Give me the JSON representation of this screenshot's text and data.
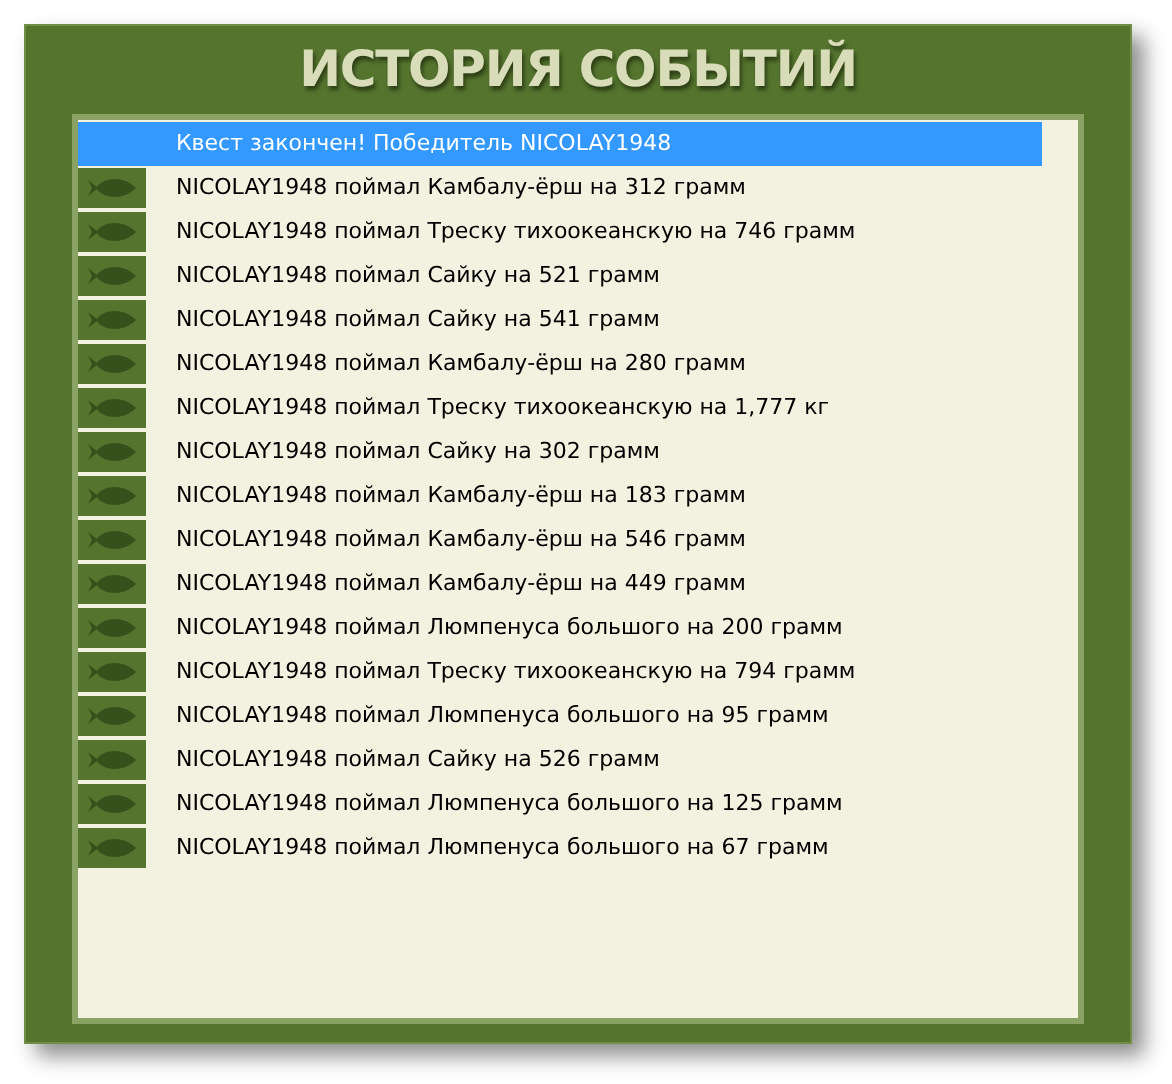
{
  "title": "ИСТОРИЯ СОБЫТИЙ",
  "events": [
    {
      "kind": "message",
      "selected": true,
      "text": "Квест закончен! Победитель NICOLAY1948"
    },
    {
      "kind": "catch",
      "selected": false,
      "text": "NICOLAY1948 поймал Камбалу-ёрш на 312 грамм"
    },
    {
      "kind": "catch",
      "selected": false,
      "text": "NICOLAY1948 поймал Треску тихоокеанскую на 746 грамм"
    },
    {
      "kind": "catch",
      "selected": false,
      "text": "NICOLAY1948 поймал Сайку на 521 грамм"
    },
    {
      "kind": "catch",
      "selected": false,
      "text": "NICOLAY1948 поймал Сайку на 541 грамм"
    },
    {
      "kind": "catch",
      "selected": false,
      "text": "NICOLAY1948 поймал Камбалу-ёрш на 280 грамм"
    },
    {
      "kind": "catch",
      "selected": false,
      "text": "NICOLAY1948 поймал Треску тихоокеанскую на 1,777 кг"
    },
    {
      "kind": "catch",
      "selected": false,
      "text": "NICOLAY1948 поймал Сайку на 302 грамм"
    },
    {
      "kind": "catch",
      "selected": false,
      "text": "NICOLAY1948 поймал Камбалу-ёрш на 183 грамм"
    },
    {
      "kind": "catch",
      "selected": false,
      "text": "NICOLAY1948 поймал Камбалу-ёрш на 546 грамм"
    },
    {
      "kind": "catch",
      "selected": false,
      "text": "NICOLAY1948 поймал Камбалу-ёрш на 449 грамм"
    },
    {
      "kind": "catch",
      "selected": false,
      "text": "NICOLAY1948 поймал Люмпенуса большого на 200 грамм"
    },
    {
      "kind": "catch",
      "selected": false,
      "text": "NICOLAY1948 поймал Треску тихоокеанскую на 794 грамм"
    },
    {
      "kind": "catch",
      "selected": false,
      "text": "NICOLAY1948 поймал Люмпенуса большого на 95 грамм"
    },
    {
      "kind": "catch",
      "selected": false,
      "text": "NICOLAY1948 поймал Сайку на 526 грамм"
    },
    {
      "kind": "catch",
      "selected": false,
      "text": "NICOLAY1948 поймал Люмпенуса большого на 125 грамм"
    },
    {
      "kind": "catch",
      "selected": false,
      "text": "NICOLAY1948 поймал Люмпенуса большого на 67 грамм"
    }
  ]
}
